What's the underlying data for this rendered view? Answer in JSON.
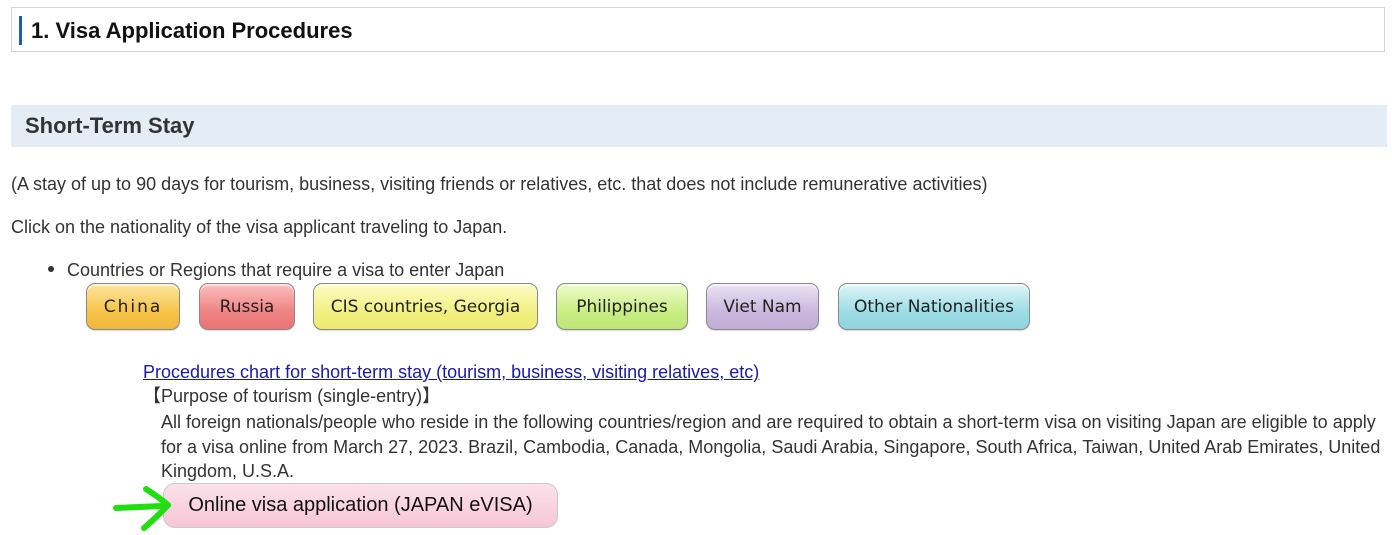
{
  "section_title": "1. Visa Application Procedures",
  "subsection_title": "Short-Term Stay",
  "note": "(A stay of up to 90 days for tourism, business, visiting friends or relatives, etc. that does not include remunerative activities)",
  "instruction": "Click on the nationality of the visa applicant traveling to Japan.",
  "bullet": "Countries or Regions that require a visa to enter Japan",
  "nationalities": [
    {
      "label": "China",
      "color": "#f6c449"
    },
    {
      "label": "Russia",
      "color": "#ef8585"
    },
    {
      "label": "CIS countries, Georgia",
      "color": "#f3f083"
    },
    {
      "label": "Philippines",
      "color": "#c9ee85"
    },
    {
      "label": "Viet Nam",
      "color": "#cbb8de"
    },
    {
      "label": "Other Nationalities",
      "color": "#9edde6"
    }
  ],
  "procedures_link": "Procedures chart for short-term stay (tourism, business, visiting relatives, etc)",
  "purpose": "【Purpose of tourism (single-entry)】",
  "description": "All foreign nationals/people who reside in the following countries/region and are required to obtain a short-term visa on visiting Japan are eligible to apply for a visa online from March 27, 2023. Brazil, Cambodia, Canada, Mongolia, Saudi Arabia, Singapore, South Africa, Taiwan, United Arab Emirates, United Kingdom, U.S.A.",
  "evisa_button": "Online visa application (JAPAN eVISA)",
  "colors": {
    "heading_accent": "#1a5fb4",
    "band_background": "#e4ecf6",
    "link": "#1a1aa6",
    "annotation_arrow": "#22dd11"
  },
  "annotation": {
    "icon": "green-arrow-icon"
  }
}
